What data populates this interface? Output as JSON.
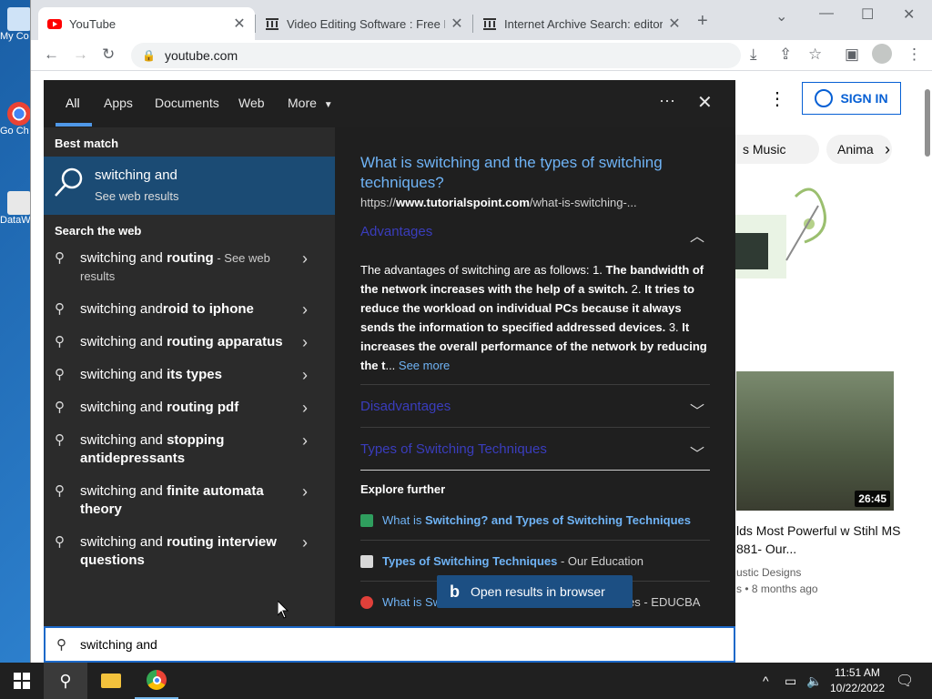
{
  "desktop": {
    "icons": [
      {
        "label": "My Co"
      },
      {
        "label": "Go Ch"
      },
      {
        "label": "DataW"
      }
    ]
  },
  "browser": {
    "tabs": [
      {
        "title": "YouTube",
        "active": true
      },
      {
        "title": "Video Editing Software : Free Do",
        "active": false
      },
      {
        "title": "Internet Archive Search: editor v",
        "active": false
      }
    ],
    "url": "youtube.com"
  },
  "youtube": {
    "signin": "SIGN IN",
    "chips": [
      "s Music",
      "Anima"
    ],
    "video": {
      "duration": "26:45",
      "title": "lds Most Powerful w Stihl MS 881- Our...",
      "channel": "ustic Designs",
      "meta": "s • 8 months ago"
    }
  },
  "search": {
    "tabs": [
      "All",
      "Apps",
      "Documents",
      "Web",
      "More"
    ],
    "best_match_heading": "Best match",
    "best_match": {
      "title": "switching and",
      "subtitle": "See web results"
    },
    "search_web_heading": "Search the web",
    "suggestions": [
      {
        "prefix": "switching and ",
        "bold": "routing",
        "note": " - See web results"
      },
      {
        "prefix": "switching and",
        "bold": "roid to iphone",
        "note": ""
      },
      {
        "prefix": "switching and ",
        "bold": "routing apparatus",
        "note": ""
      },
      {
        "prefix": "switching and ",
        "bold": "its types",
        "note": ""
      },
      {
        "prefix": "switching and ",
        "bold": "routing pdf",
        "note": ""
      },
      {
        "prefix": "switching and ",
        "bold": "stopping antidepressants",
        "note": ""
      },
      {
        "prefix": "switching and ",
        "bold": "finite automata theory",
        "note": ""
      },
      {
        "prefix": "switching and ",
        "bold": "routing interview questions",
        "note": ""
      }
    ],
    "result": {
      "title": "What is switching and the types of switching techniques?",
      "url_prefix": "https://",
      "url_domain": "www.tutorialspoint.com",
      "url_rest": "/what-is-switching-...",
      "sections": [
        "Advantages",
        "Disadvantages",
        "Types of Switching Techniques"
      ],
      "paragraph_parts": [
        {
          "t": "The advantages of switching are as follows: 1. ",
          "b": false
        },
        {
          "t": "The bandwidth of the network increases with the help of a switch.",
          "b": true
        },
        {
          "t": " 2. ",
          "b": false
        },
        {
          "t": "It tries to reduce the workload on individual PCs because it always sends the information to specified addressed devices.",
          "b": true
        },
        {
          "t": " 3. ",
          "b": false
        },
        {
          "t": "It increases the overall performance of the network by reducing the t",
          "b": true
        },
        {
          "t": "...",
          "b": false
        }
      ],
      "see_more": "See more",
      "explore_heading": "Explore further",
      "explore_links": [
        {
          "pre": "What is ",
          "bold": "Switching? and Types of Switching Techniques",
          "source": ""
        },
        {
          "pre": "",
          "bold": "Types of Switching Techniques",
          "source": " - Our Education"
        },
        {
          "pre": "What is Sw",
          "bold": "",
          "source": "es - EDUCBA"
        }
      ]
    },
    "open_in_browser": "Open results in browser",
    "query": "switching and"
  },
  "taskbar": {
    "time": "11:51 AM",
    "date": "10/22/2022"
  },
  "colors": {
    "accent": "#1c69c9",
    "link": "#6fb3f5",
    "best_match_bg": "#1b4b74",
    "youtube_red": "#ff0000"
  }
}
